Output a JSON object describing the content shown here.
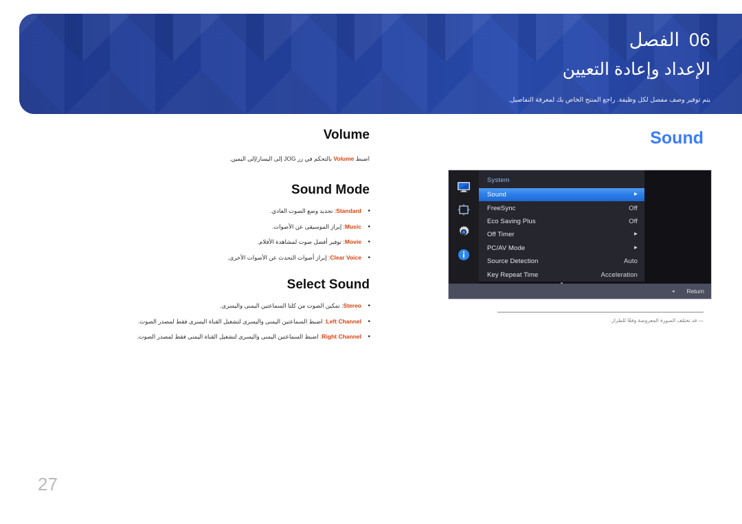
{
  "header": {
    "chapter_label": "الفصل",
    "chapter_number": "06",
    "title": "الإعداد وإعادة التعيين",
    "subtitle": "يتم توفير وصف مفصل لكل وظيفة. راجع المنتج الخاص بك لمعرفة التفاصيل."
  },
  "section": {
    "title": "Sound"
  },
  "volume": {
    "heading": "Volume",
    "description_before": "اضبط ",
    "description_keyword": "Volume",
    "description_after": " بالتحكم في زر JOG إلى اليسار/إلى اليمين."
  },
  "sound_mode": {
    "heading": "Sound Mode",
    "items": [
      {
        "keyword": "Standard",
        "text": ": تحديد وضع الصوت العادي."
      },
      {
        "keyword": "Music",
        "text": ": إبراز الموسيقى عن الأصوات."
      },
      {
        "keyword": "Movie",
        "text": ": توفير أفضل صوت لمشاهدة الأفلام."
      },
      {
        "keyword": "Clear Voice",
        "text": ": إبراز أصوات التحدث عن الأصوات الأخرى."
      }
    ]
  },
  "select_sound": {
    "heading": "Select Sound",
    "items": [
      {
        "keyword": "Stereo",
        "text": ": تمكين الصوت من كلتا السماعتين اليمنى واليسرى."
      },
      {
        "keyword": "Left Channel",
        "text": ": اضبط السماعتين اليمنى واليسرى لتشغيل القناة اليسرى فقط لمصدر الصوت."
      },
      {
        "keyword": "Right Channel",
        "text": ": اضبط السماعتين اليمنى واليسرى لتشغيل القناة اليمنى فقط لمصدر الصوت."
      }
    ]
  },
  "osd": {
    "menu_title": "System",
    "sidebar_icons": [
      "monitor-icon",
      "picture-size-icon",
      "settings-gear-icon",
      "information-icon"
    ],
    "rows": [
      {
        "label": "Sound",
        "value": "",
        "arrow": "▸",
        "selected": true
      },
      {
        "label": "FreeSync",
        "value": "Off",
        "arrow": "",
        "selected": false
      },
      {
        "label": "Eco Saving Plus",
        "value": "Off",
        "arrow": "",
        "selected": false
      },
      {
        "label": "Off Timer",
        "value": "",
        "arrow": "▸",
        "selected": false
      },
      {
        "label": "PC/AV Mode",
        "value": "",
        "arrow": "▸",
        "selected": false
      },
      {
        "label": "Source Detection",
        "value": "Auto",
        "arrow": "",
        "selected": false
      },
      {
        "label": "Key Repeat Time",
        "value": "Acceleration",
        "arrow": "",
        "selected": false
      }
    ],
    "scroll_down_glyph": "▾",
    "return_label": "Return",
    "return_glyph": "◂",
    "footnote": "قد تختلف الصورة المعروضة وفقًا للطراز.",
    "footnote_marker": "―"
  },
  "footer": {
    "page_number": "27"
  },
  "colors": {
    "banner_blue": "#23409a",
    "accent_blue": "#3a7cf5",
    "keyword_orange": "#d9430f",
    "osd_highlight": "#2b7de8"
  }
}
